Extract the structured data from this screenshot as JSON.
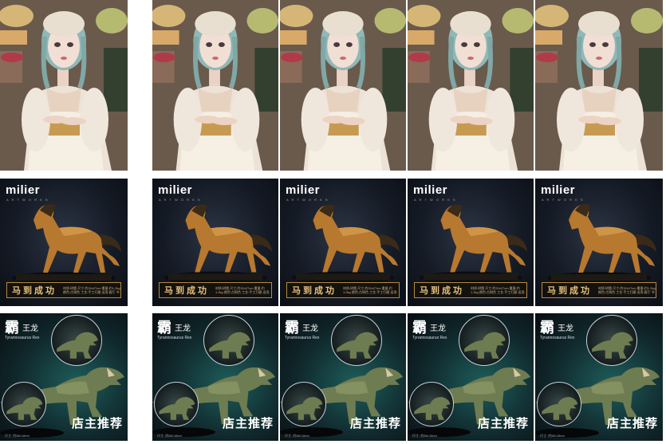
{
  "horse_cards": {
    "brand": "milier",
    "brand_sub": "A R T W O R K S",
    "banner_title": "马到成功",
    "banner_text": "材质:树脂 尺寸:约32x27cm 重量:约1.2kg 颜色:古铜色 工艺:手工打磨 适用:客厅 书房 办公室 玄关 摆件 寓意:马到成功 事业顺利"
  },
  "dino_cards": {
    "title_main": "霸",
    "title_sub": "王龙",
    "latin": "Tyrannosaurus Rex",
    "recommend": "店主推荐",
    "footer": "尺寸: 约58×18cm"
  },
  "colors": {
    "horse_bronze": "#b7782f",
    "banner_gold": "#e7c27a",
    "dino_green": "#6e7c52",
    "doll_hair": "#8fb8b6"
  }
}
